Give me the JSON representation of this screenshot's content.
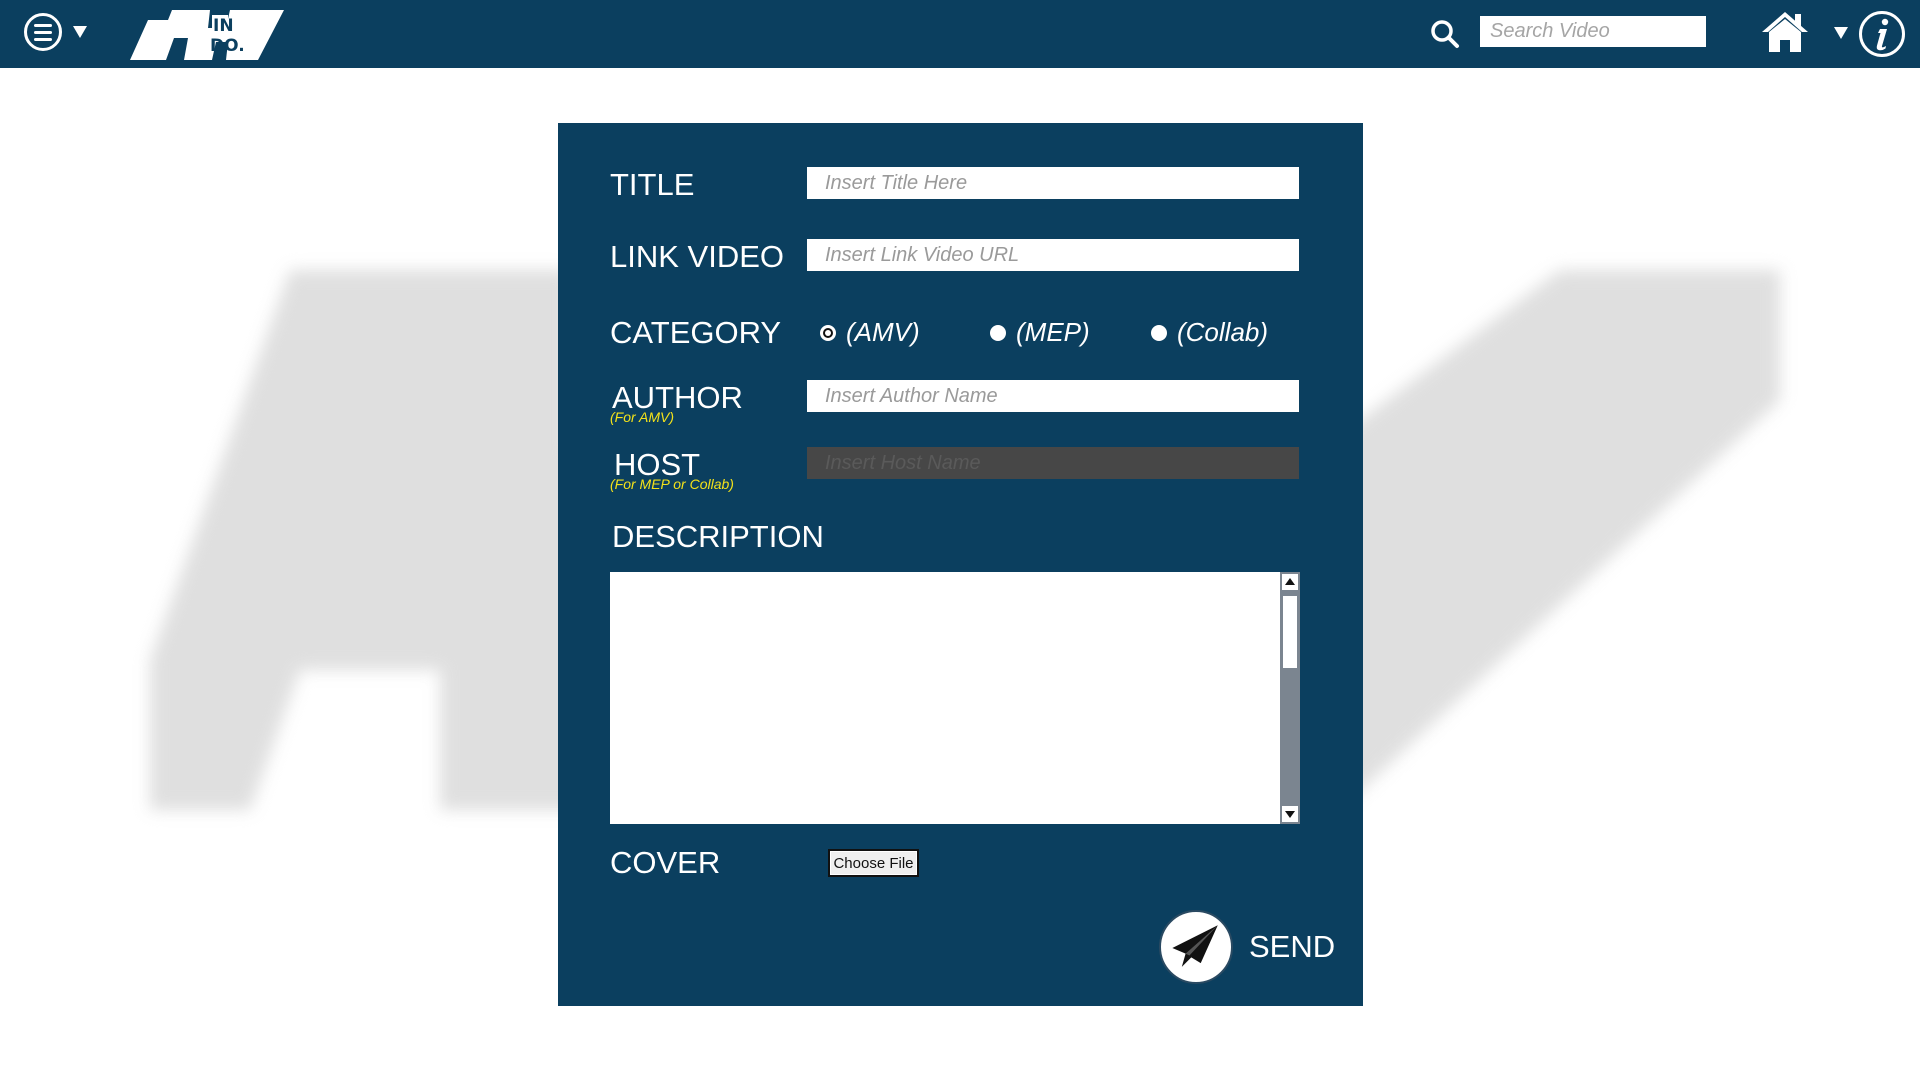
{
  "header": {
    "logo_text_top": "IN",
    "logo_text_bottom": "DO.",
    "search_placeholder": "Search Video"
  },
  "form": {
    "title_label": "TITLE",
    "title_placeholder": "Insert Title Here",
    "link_label": "LINK VIDEO",
    "link_placeholder": "Insert Link Video URL",
    "category_label": "CATEGORY",
    "categories": [
      {
        "label": "(AMV)",
        "selected": true
      },
      {
        "label": "(MEP)",
        "selected": false
      },
      {
        "label": "(Collab)",
        "selected": false
      }
    ],
    "author_label": "AUTHOR",
    "author_note": "(For AMV)",
    "author_placeholder": "Insert Author Name",
    "host_label": "HOST",
    "host_note": "(For MEP or Collab)",
    "host_placeholder": "Insert Host Name",
    "description_label": "DESCRIPTION",
    "description_value": "",
    "cover_label": "COVER",
    "choose_file_label": "Choose File",
    "send_label": "SEND"
  },
  "colors": {
    "navy": "#0b3f5f",
    "note_yellow": "#f3e21a",
    "disabled_field": "#474747"
  }
}
